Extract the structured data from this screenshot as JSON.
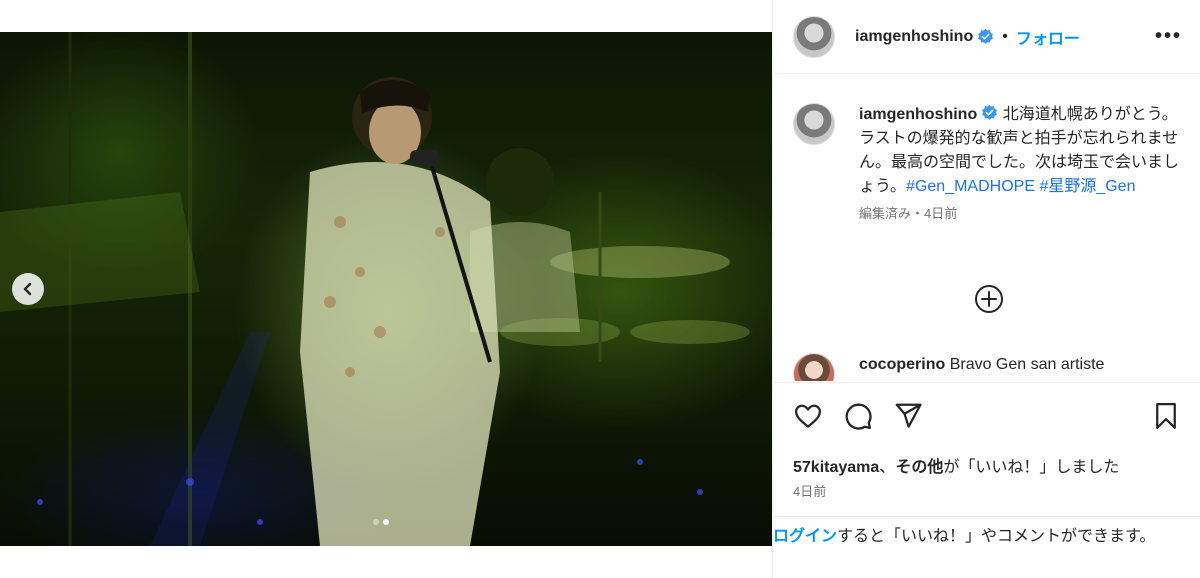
{
  "post": {
    "username": "iamgenhoshino",
    "follow_label": "フォロー",
    "separator": "•",
    "more_label": "•••"
  },
  "caption": {
    "username": "iamgenhoshino",
    "text": "北海道札幌ありがとう。ラストの爆発的な歓声と拍手が忘れられません。最高の空間でした。次は埼玉で会いましょう。",
    "hashtag1": "#Gen_MADHOPE",
    "hashtag2": "#星野源_Gen",
    "meta": "編集済み・4日前"
  },
  "comment": {
    "username": "cocoperino",
    "text": "Bravo Gen san artiste"
  },
  "likes": {
    "user": "57kitayama",
    "connector": "、",
    "others": "その他",
    "suffix": "が「いいね！」しました",
    "date": "4日前"
  },
  "login": {
    "link": "ログイン",
    "text": "すると「いいね！」やコメントができます。"
  },
  "carousel": {
    "total": 2,
    "current": 2
  },
  "colors": {
    "accent": "#0095f6",
    "verified": "#3897f0",
    "hashtag": "#1a73e8"
  }
}
